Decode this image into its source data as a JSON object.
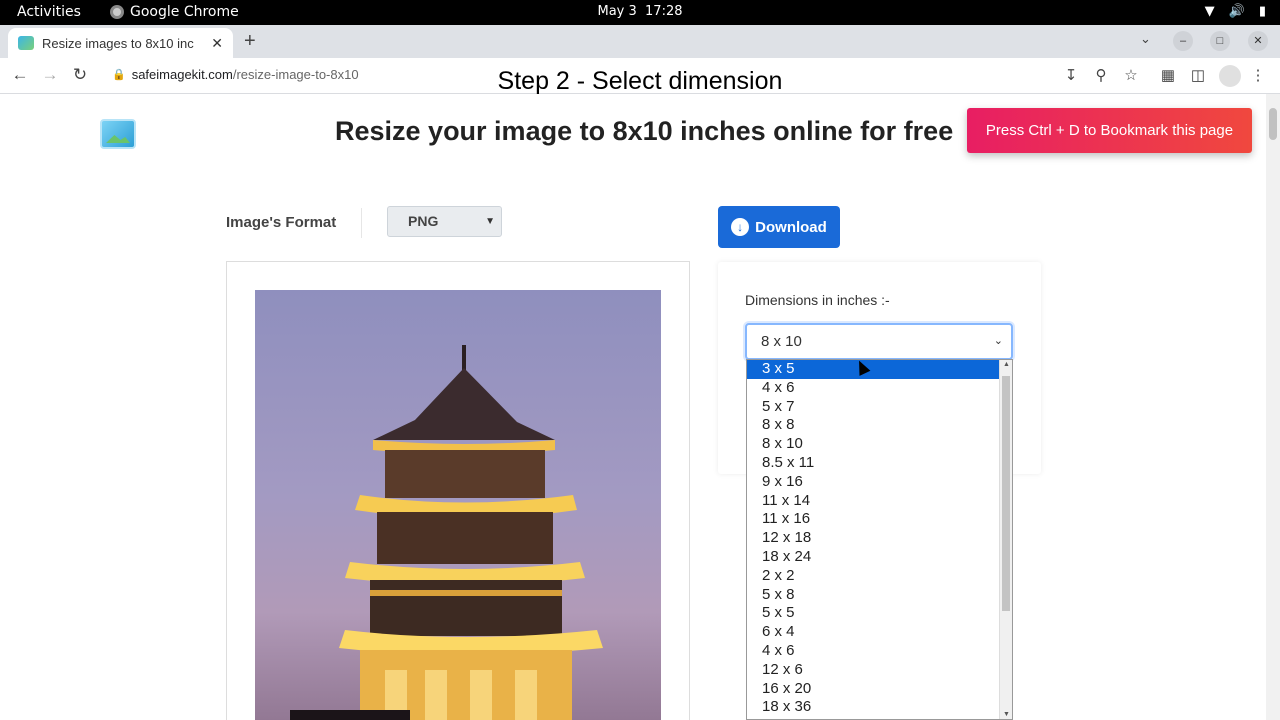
{
  "os_bar": {
    "activities": "Activities",
    "app_name": "Google Chrome",
    "date": "May 3",
    "time": "17:28"
  },
  "browser": {
    "tab_title": "Resize images to 8x10 inc",
    "url_domain": "safeimagekit.com",
    "url_path": "/resize-image-to-8x10"
  },
  "caption": "Step 2 - Select dimension",
  "page": {
    "title": "Resize your image to 8x10 inches online for free",
    "toast": "Press Ctrl + D to Bookmark this page",
    "format_label": "Image's Format",
    "format_value": "PNG",
    "download_label": "Download",
    "dimensions_label": "Dimensions in inches :-",
    "dimension_value": "8 x 10",
    "dimension_options": [
      "3 x 5",
      "4 x 6",
      "5 x 7",
      "8 x 8",
      "8 x 10",
      "8.5 x 11",
      "9 x 16",
      "11 x 14",
      "11 x 16",
      "12 x 18",
      "18 x 24",
      "2 x 2",
      "5 x 8",
      "5 x 5",
      "6 x 4",
      "4 x 6",
      "12 x 6",
      "16 x 20",
      "18 x 36"
    ],
    "highlighted_option": "3 x 5"
  },
  "colors": {
    "toast": "#e81e63",
    "download": "#1a6ad8",
    "option_highlight": "#0c67d8"
  }
}
